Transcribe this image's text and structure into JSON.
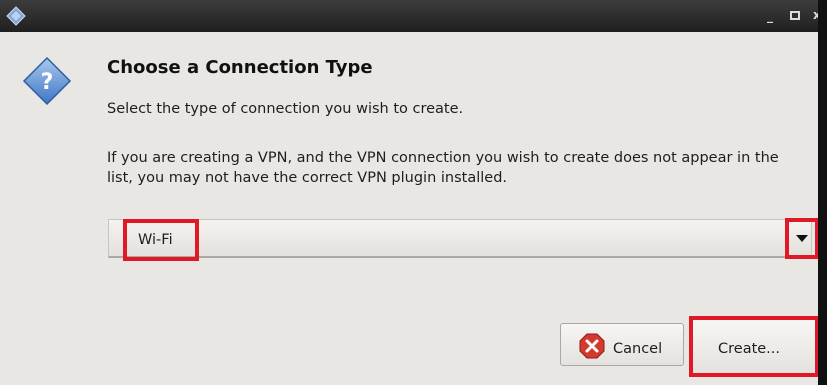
{
  "titlebar": {
    "minimize_glyph": "_",
    "close_glyph": "x"
  },
  "dialog": {
    "heading": "Choose a Connection Type",
    "subtext": "Select the type of connection you wish to create.",
    "explanation": "If you are creating a VPN, and the VPN connection you wish to create does not appear in the list, you may not have the correct VPN plugin installed."
  },
  "combo": {
    "selected_value": "Wi-Fi"
  },
  "buttons": {
    "cancel_label": "Cancel",
    "create_label": "Create..."
  },
  "colors": {
    "highlight": "#e11826",
    "question_icon": "#5b8fd1",
    "cancel_icon": "#d33a2f"
  },
  "icons": {
    "titlebar": "app-diamond-icon",
    "dialog": "question-icon",
    "combo": "chevron-down-icon",
    "cancel": "cancel-icon"
  }
}
